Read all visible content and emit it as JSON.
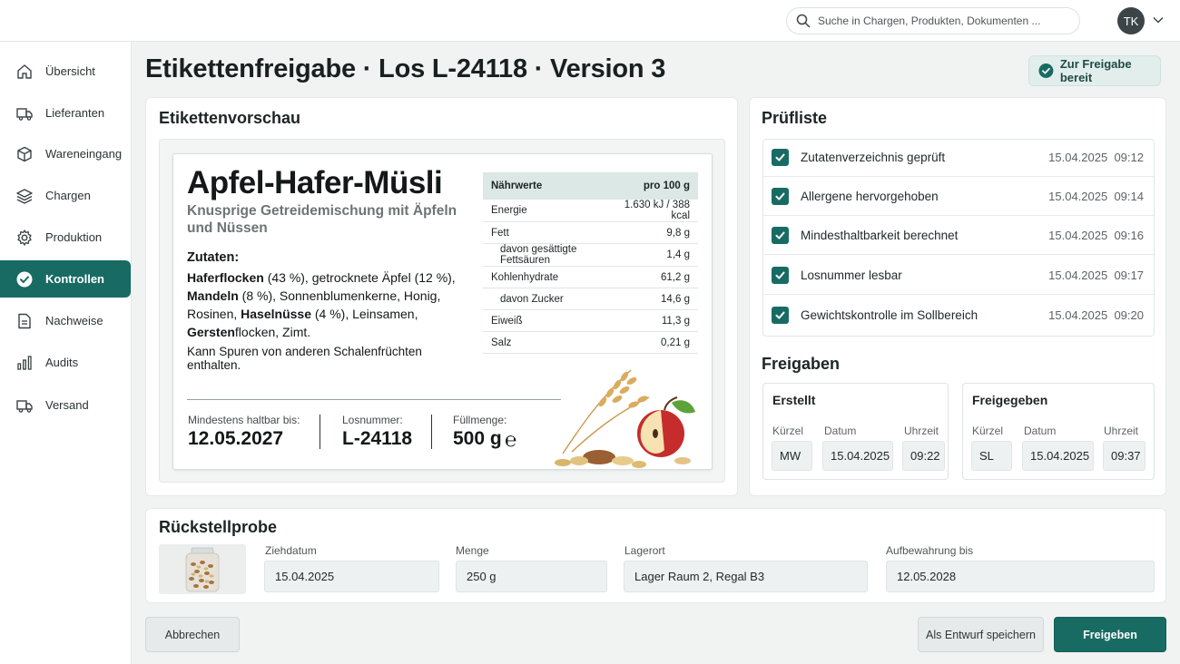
{
  "search": {
    "placeholder": "Suche in Chargen, Produkten, Dokumenten ..."
  },
  "user": {
    "initials": "TK"
  },
  "sidebar": {
    "items": [
      {
        "label": "Übersicht",
        "icon": "home-icon"
      },
      {
        "label": "Lieferanten",
        "icon": "truck-icon"
      },
      {
        "label": "Wareneingang",
        "icon": "box-icon"
      },
      {
        "label": "Chargen",
        "icon": "layers-icon"
      },
      {
        "label": "Produktion",
        "icon": "gear-icon"
      },
      {
        "label": "Kontrollen",
        "icon": "check-circle-icon",
        "active": true
      },
      {
        "label": "Nachweise",
        "icon": "document-icon"
      },
      {
        "label": "Audits",
        "icon": "bar-chart-icon"
      },
      {
        "label": "Versand",
        "icon": "truck-icon"
      }
    ]
  },
  "page": {
    "title": "Etikettenfreigabe · Los L-24118 · Version 3",
    "status": "Zur Freigabe bereit"
  },
  "preview": {
    "title": "Etikettenvorschau",
    "product_name": "Apfel-Hafer-Müsli",
    "product_subtitle": "Knusprige Getreidemischung mit Äpfeln und Nüssen",
    "ingredients_title": "Zutaten:",
    "ingredients": {
      "p1": "Haferflocken",
      "p2": " (43 %), getrocknete Äpfel (12 %), ",
      "p3": "Mandeln",
      "p4": " (8 %), Sonnenblumenkerne, Honig, Rosinen, ",
      "p5": "Haselnüsse",
      "p6": " (4 %), Leinsamen, ",
      "p7": "Gersten",
      "p8": "flocken, Zimt."
    },
    "trace_prefix": "Kann Spuren von anderen ",
    "trace_bold": "Schalenfrüchten",
    "trace_suffix": " enthalten.",
    "best_before_label": "Mindestens haltbar bis:",
    "best_before": "12.05.2027",
    "lot_label": "Losnummer:",
    "lot": "L-24118",
    "fill_label": "Füllmenge:",
    "fill": "500 g",
    "estamp": "℮",
    "nutrition": {
      "header": "Nährwerte",
      "per": "pro 100 g",
      "rows": [
        {
          "name": "Energie",
          "value": "1.630 kJ / 388 kcal"
        },
        {
          "name": "Fett",
          "value": "9,8 g"
        },
        {
          "name": "davon gesättigte Fettsäuren",
          "value": "1,4 g",
          "sub": true
        },
        {
          "name": "Kohlenhydrate",
          "value": "61,2 g"
        },
        {
          "name": "davon Zucker",
          "value": "14,6 g",
          "sub": true
        },
        {
          "name": "Eiweiß",
          "value": "11,3 g"
        },
        {
          "name": "Salz",
          "value": "0,21 g"
        }
      ]
    }
  },
  "checklist": {
    "title": "Prüfliste",
    "items": [
      {
        "label": "Zutatenverzeichnis geprüft",
        "date": "15.04.2025",
        "time": "09:12"
      },
      {
        "label": "Allergene hervorgehoben",
        "date": "15.04.2025",
        "time": "09:14"
      },
      {
        "label": "Mindesthaltbarkeit berechnet",
        "date": "15.04.2025",
        "time": "09:16"
      },
      {
        "label": "Losnummer lesbar",
        "date": "15.04.2025",
        "time": "09:17"
      },
      {
        "label": "Gewichtskontrolle im Sollbereich",
        "date": "15.04.2025",
        "time": "09:20"
      }
    ]
  },
  "approvals": {
    "title": "Freigaben",
    "created": {
      "title": "Erstellt",
      "initials": "MW",
      "date": "15.04.2025",
      "time": "09:22"
    },
    "approved": {
      "title": "Freigegeben",
      "initials": "SL",
      "date": "15.04.2025",
      "time": "09:37"
    },
    "labels": {
      "initials": "Kürzel",
      "date": "Datum",
      "time": "Uhrzeit"
    }
  },
  "retain_sample": {
    "title": "Rückstellprobe",
    "draw_date_label": "Ziehdatum",
    "draw_date": "15.04.2025",
    "amount_label": "Menge",
    "amount": "250 g",
    "location_label": "Lagerort",
    "location": "Lager Raum 2, Regal B3",
    "keep_until_label": "Aufbewahrung bis",
    "keep_until": "12.05.2028"
  },
  "actions": {
    "cancel": "Abbrechen",
    "save_draft": "Als Entwurf speichern",
    "approve": "Freigeben"
  }
}
